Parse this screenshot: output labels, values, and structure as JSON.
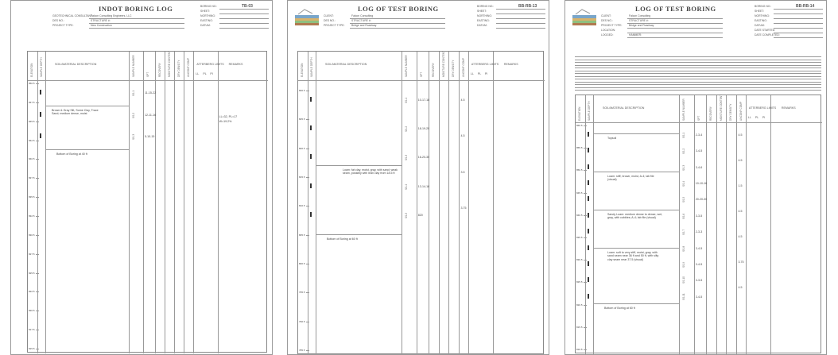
{
  "sheets": [
    {
      "title": "INDOT BORING LOG",
      "header_left": [
        "GEOTECHNICAL CONSULTANT:",
        "DES NO.:",
        "PROJECT TYPE:"
      ],
      "header_mid": [
        "Falcon Consulting Engineers, LLC",
        "STRUCTURE #:",
        "New Construction"
      ],
      "header_right": [
        "BORING NO.:",
        "SHEET:",
        "NORTHING:",
        "EASTING:",
        "DATUM:"
      ],
      "boring_no": "TB-03",
      "columns": [
        "ELEVATION",
        "SAMPLE DEPTH",
        "SOIL/MATERIAL DESCRIPTION",
        "SAMPLE NUMBER",
        "SPT",
        "RECOVERY",
        "MOISTURE CONTENT",
        "DRY DENSITY",
        "UNCONF COMP",
        "ATTERBERG LIMITS",
        "REMARKS"
      ],
      "atterberg": [
        "LL",
        "PL",
        "PI"
      ],
      "elevations": [
        "850.5",
        "847.5",
        "845.5",
        "842.5",
        "840.5",
        "837.5",
        "835.5",
        "832.5",
        "830.5",
        "827.5",
        "825.5",
        "822.5",
        "820.5",
        "817.5",
        "815.5"
      ],
      "layers": [
        {
          "desc": "Brown & Gray Silt, Some Clay, Trace Sand; medium dense, moist",
          "end": "Bottom of Boring at 40 ft"
        }
      ],
      "samples": [
        "SS-1",
        "SS-2",
        "SS-3"
      ],
      "spt": [
        "11-15-22",
        "12-11-16",
        "5-10-15"
      ],
      "remarks": [
        "LL=32, PL=17",
        "W=19.2%"
      ]
    },
    {
      "title": "LOG OF TEST BORING",
      "header_left": [
        "CLIENT:",
        "DES NO.:",
        "PROJECT TYPE:"
      ],
      "header_mid": [
        "Falcon Consulting",
        "STRUCTURE #:",
        "Bridge and Roadway"
      ],
      "header_right": [
        "BORING NO.:",
        "SHEET:",
        "NORTHING:",
        "EASTING:",
        "DATUM:"
      ],
      "boring_no": "BB-RB-13",
      "columns": [
        "ELEVATION",
        "SAMPLE DEPTH",
        "SOIL/MATERIAL DESCRIPTION",
        "SAMPLE NUMBER",
        "SPT",
        "RECOVERY",
        "MOISTURE CONTENT",
        "DRY DENSITY",
        "UNCONF COMP",
        "ATTERBERG LIMITS",
        "REMARKS"
      ],
      "atterberg": [
        "LL",
        "PL",
        "PI"
      ],
      "elevations": [
        "830.5",
        "825.5",
        "820.5",
        "815.5",
        "810.5",
        "805.5",
        "800.5",
        "795.5",
        "790.5",
        "785.5"
      ],
      "layers": [
        {
          "desc": "Loam: fat clay, moist, gray, with sand; weak seam, possibly with lean clay from 18.5 ft",
          "end": "Bottom of Boring at 60 ft"
        }
      ],
      "samples": [
        "SS-1",
        "SS-2",
        "SS-3",
        "SS-4",
        "SS-5"
      ],
      "spt": [
        "10-17-18",
        "18-19-20",
        "16-20-30",
        "13-14-18",
        "820"
      ],
      "values": [
        "4.5",
        "4.5",
        "3.5",
        "3.75"
      ]
    },
    {
      "title": "LOG OF TEST BORING",
      "header_left": [
        "CLIENT:",
        "DES NO.:",
        "PROJECT TYPE:",
        "LOCATION:",
        "LOGGED:"
      ],
      "header_mid": [
        "Falcon Consulting",
        "STRUCTURE #:",
        "Bridge and Roadway",
        "",
        "HAMMER:"
      ],
      "header_right": [
        "BORING NO.:",
        "SHEET:",
        "NORTHING:",
        "EASTING:",
        "DATUM:",
        "DATE STARTED:",
        "DATE COMPLETED:"
      ],
      "boring_no": "BB-RB-14",
      "columns": [
        "ELEVATION",
        "SAMPLE DEPTH",
        "SOIL/MATERIAL DESCRIPTION",
        "SAMPLE NUMBER",
        "SPT",
        "RECOVERY",
        "MOISTURE CONTENT",
        "DRY DENSITY",
        "UNCONF COMP",
        "ATTERBERG LIMITS",
        "REMARKS"
      ],
      "atterberg": [
        "LL",
        "PL",
        "PI"
      ],
      "elevations": [
        "860.5",
        "855.5",
        "850.5",
        "845.5",
        "840.5",
        "835.5",
        "830.5",
        "825.5",
        "820.5",
        "815.5",
        "810.5"
      ],
      "layers": [
        {
          "desc": "Topsoil"
        },
        {
          "desc": "Loam: stiff, brown, moist, A-4; lab file (visual)"
        },
        {
          "desc": "Sandy Loam: medium dense to dense, wet, gray, with cobbles; A-4; lab file (visual)"
        },
        {
          "desc": "Loam: soft to very stiff, moist, gray, with sand seam near 36 ft and 50 ft, with silty clay seam near 37.5 (visual)",
          "end": "Bottom of Boring at 60 ft"
        }
      ],
      "samples": [
        "SS-1",
        "SS-2",
        "SS-3",
        "SS-4",
        "SS-5",
        "SS-6",
        "SS-7",
        "SS-8",
        "SS-9",
        "SS-10",
        "SS-11"
      ],
      "spt": [
        "2-3-4",
        "3-4-5",
        "3-4-6",
        "10-10-16",
        "20-20-30",
        "3-3-5",
        "2-3-3",
        "3-4-5",
        "3-4-5",
        "3-3-5",
        "3-4-5"
      ],
      "values": [
        "4.5",
        "4.5",
        "1.5",
        "4.5",
        "4.5",
        "3.75",
        "4.5"
      ]
    }
  ]
}
